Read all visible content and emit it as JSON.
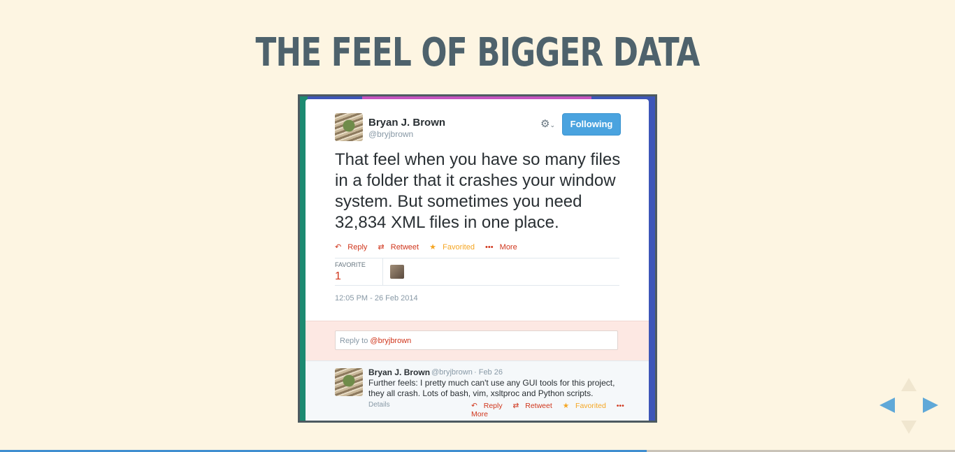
{
  "slide": {
    "title": "THE FEEL OF BIGGER DATA"
  },
  "tweet": {
    "author": "Bryan J. Brown",
    "handle": "@bryjbrown",
    "follow_label": "Following",
    "gear_icon": "gear-icon",
    "text": "That feel when you have so many files in a folder that it crashes your window system. But sometimes you need 32,834 XML files in one place.",
    "actions": {
      "reply": "Reply",
      "retweet": "Retweet",
      "favorited": "Favorited",
      "more": "More"
    },
    "stats": {
      "label": "FAVORITE",
      "value": "1"
    },
    "timestamp": "12:05 PM - 26 Feb 2014"
  },
  "reply_box": {
    "prefix": "Reply to ",
    "mention": "@bryjbrown"
  },
  "reply_tweet": {
    "author": "Bryan J. Brown",
    "handle": "@bryjbrown",
    "date": "· Feb 26",
    "text": "Further feels: I pretty much can't use any GUI tools for this project, they all crash. Lots of bash, vim, xsltproc and Python scripts.",
    "details": "Details",
    "actions": {
      "reply": "Reply",
      "retweet": "Retweet",
      "favorited": "Favorited",
      "more": "More"
    }
  },
  "colors": {
    "title": "#4e626c",
    "link": "#d0361c",
    "accent": "#4aa3df",
    "nav": "#5fa8d8",
    "background": "#fdf5e2"
  },
  "presentation": {
    "progress": 0.677
  }
}
